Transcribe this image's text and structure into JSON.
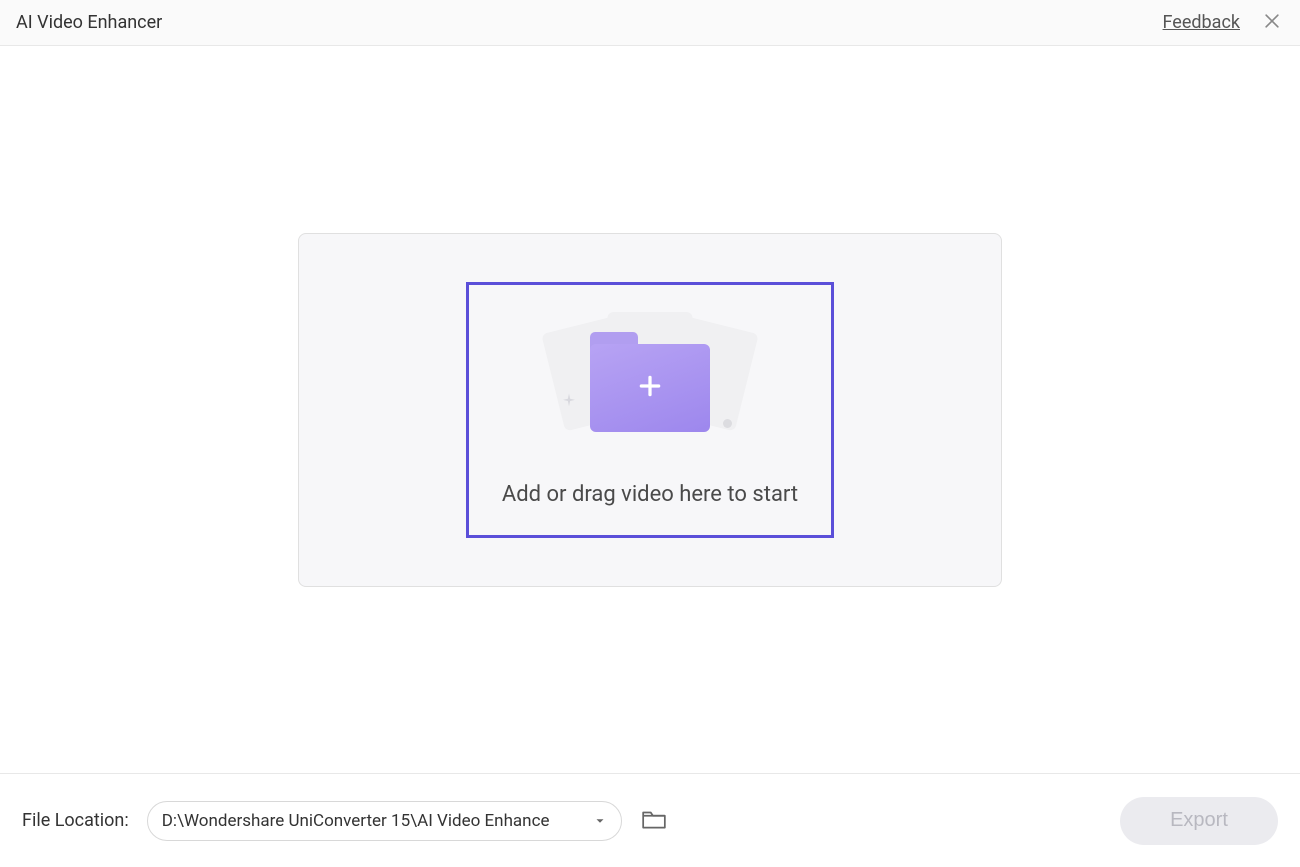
{
  "header": {
    "title": "AI Video Enhancer",
    "feedback_label": "Feedback"
  },
  "dropzone": {
    "prompt_text": "Add or drag video here to start"
  },
  "footer": {
    "file_location_label": "File Location:",
    "file_location_path": "D:\\Wondershare UniConverter 15\\AI Video Enhance",
    "export_label": "Export"
  }
}
